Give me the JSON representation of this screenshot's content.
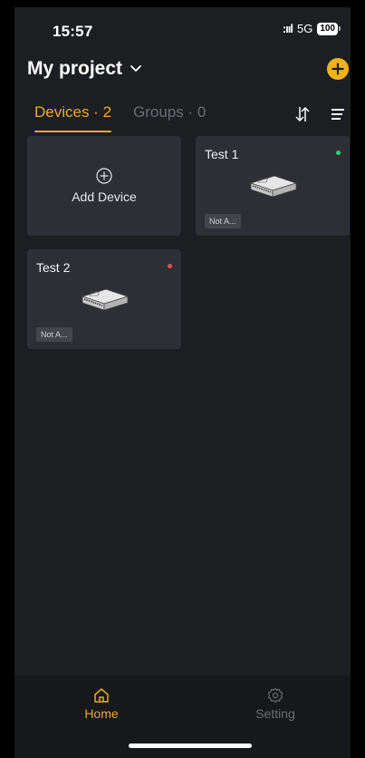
{
  "status_bar": {
    "time": "15:57",
    "signal": ":ııl",
    "network": "5G",
    "battery": "100"
  },
  "header": {
    "project_title": "My project",
    "add_icon": "plus-circle-icon"
  },
  "tabs": [
    {
      "label": "Devices · 2",
      "active": true
    },
    {
      "label": "Groups · 0",
      "active": false
    }
  ],
  "toolbar": {
    "sort_icon": "sort-arrows-icon",
    "list_icon": "list-icon"
  },
  "add_device": {
    "label": "Add Device",
    "icon": "plus-circle-icon"
  },
  "devices": [
    {
      "name": "Test 1",
      "status_color": "#2ecc71",
      "badge": "Not A..."
    },
    {
      "name": "Test 2",
      "status_color": "#e94b4b",
      "badge": "Not A..."
    }
  ],
  "bottom_nav": [
    {
      "label": "Home",
      "icon": "home-icon",
      "active": true,
      "color": "#e9ac2a"
    },
    {
      "label": "Setting",
      "icon": "gear-icon",
      "active": false,
      "color": "#6c6d72"
    }
  ],
  "colors": {
    "accent": "#e9ac2a",
    "background": "#1d1e22",
    "card": "#2e2f35"
  }
}
